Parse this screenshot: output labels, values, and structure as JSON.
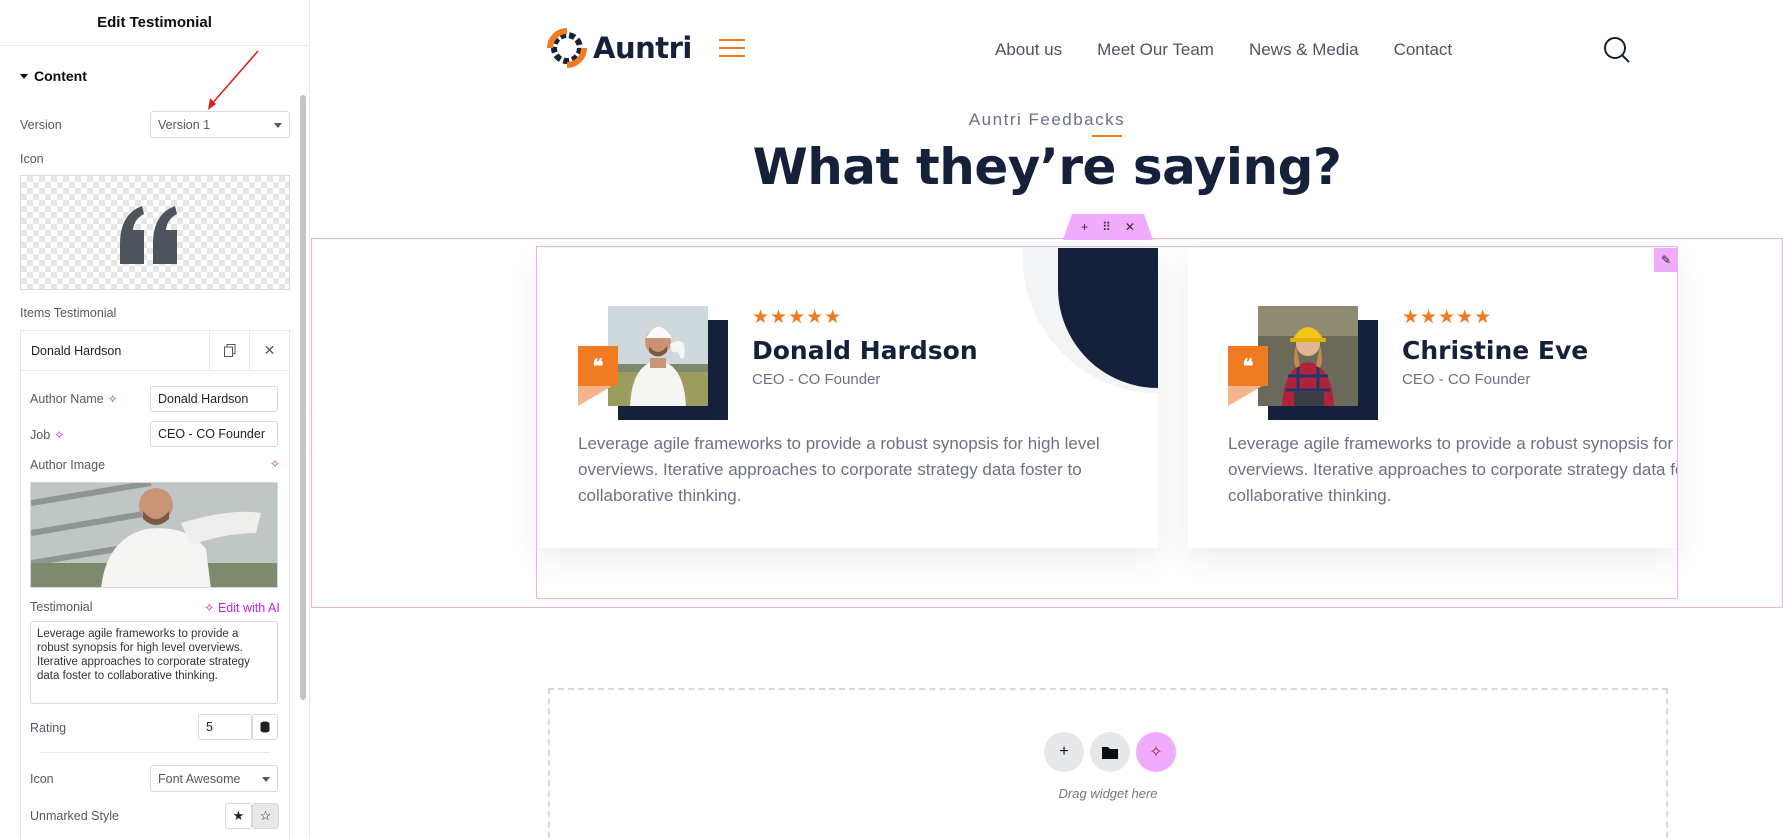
{
  "sidebar": {
    "title": "Edit Testimonial",
    "section_label": "Content",
    "version_label": "Version",
    "version_value": "Version 1",
    "icon_label": "Icon",
    "items_label": "Items Testimonial",
    "item": {
      "title": "Donald Hardson",
      "author_name_label": "Author Name",
      "author_name_value": "Donald Hardson",
      "job_label": "Job",
      "job_value": "CEO - CO Founder",
      "author_image_label": "Author Image",
      "testimonial_label": "Testimonial",
      "edit_ai_label": "Edit with AI",
      "testimonial_value": "Leverage agile frameworks to provide a robust synopsis for high level overviews. Iterative approaches to corporate strategy data foster to collaborative thinking.",
      "rating_label": "Rating",
      "rating_value": "5",
      "icon_label": "Icon",
      "icon_value": "Font Awesome",
      "unmarked_style_label": "Unmarked Style"
    }
  },
  "site": {
    "logo_text": "Auntri",
    "nav": [
      "About us",
      "Meet Our Team",
      "News & Media",
      "Contact"
    ],
    "kicker": "Auntri Feedbacks",
    "heading": "What they’re saying?"
  },
  "testimonials": [
    {
      "stars": "★★★★★",
      "name": "Donald Hardson",
      "job": "CEO - CO Founder",
      "text": "Leverage agile frameworks to provide a robust synopsis for high level overviews. Iterative approaches to corporate strategy data foster to collaborative thinking."
    },
    {
      "stars": "★★★★★",
      "name": "Christine Eve",
      "job": "CEO - CO Founder",
      "text": "Leverage agile frameworks to provide a robust synopsis for high level overviews. Iterative approaches to corporate strategy data foster to collaborative thinking."
    }
  ],
  "dropzone": {
    "label": "Drag widget here"
  },
  "colors": {
    "accent": "#f07b20",
    "navy": "#15203a",
    "editor_pink": "#f0abfc"
  }
}
